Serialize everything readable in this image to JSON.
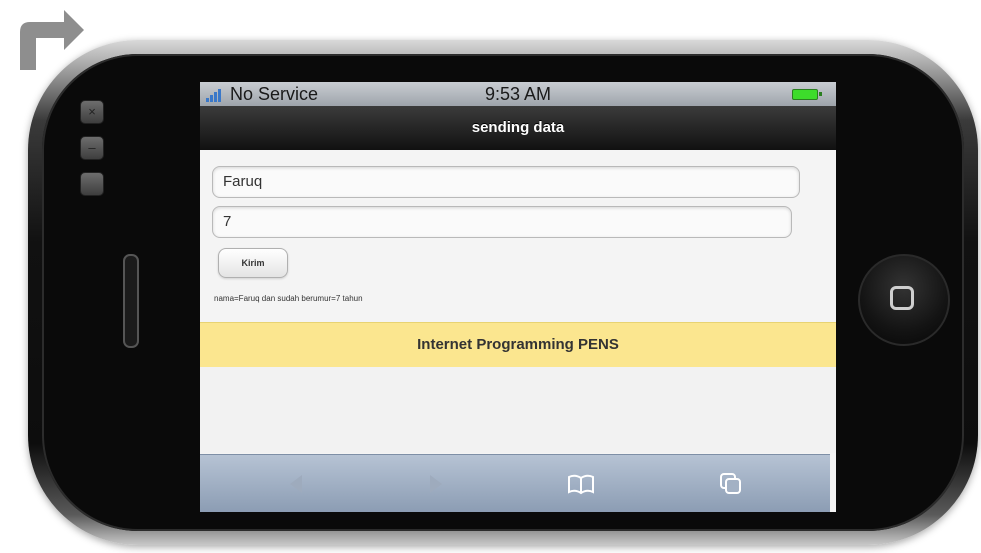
{
  "status": {
    "carrier": "No Service",
    "time": "9:53 AM",
    "battery_color": "#3ddc2b"
  },
  "header": {
    "title": "sending data"
  },
  "form": {
    "name_value": "Faruq",
    "age_value": "7",
    "submit_label": "Kirim"
  },
  "result_text": "nama=Faruq dan sudah berumur=7 tahun",
  "footer": {
    "text": "Internet Programming PENS",
    "color": "#fbe68f"
  },
  "toolbar": {
    "icons": [
      "back-arrow-icon",
      "forward-arrow-icon",
      "bookmarks-icon",
      "pages-icon"
    ]
  },
  "phone": {
    "side_buttons": [
      "close-icon",
      "minimize-icon",
      "maximize-icon"
    ]
  }
}
